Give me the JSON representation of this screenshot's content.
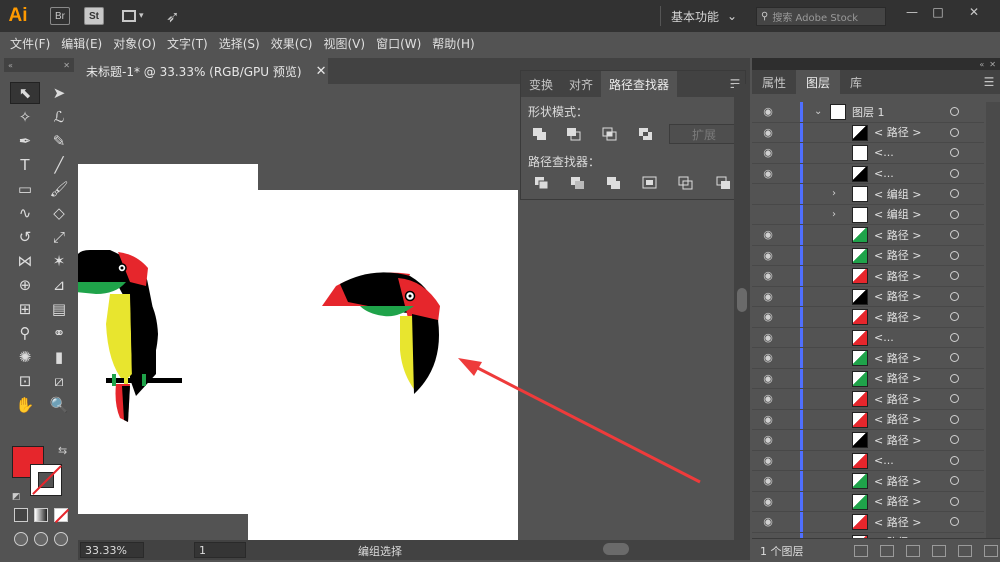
{
  "app": {
    "logo": "Ai",
    "bridge_icon": "Br",
    "stock_icon": "St",
    "workspace_label": "基本功能",
    "search_placeholder": "搜索 Adobe Stock"
  },
  "menu": [
    "文件(F)",
    "编辑(E)",
    "对象(O)",
    "文字(T)",
    "选择(S)",
    "效果(C)",
    "视图(V)",
    "窗口(W)",
    "帮助(H)"
  ],
  "document": {
    "tab_title": "未标题-1* @ 33.33% (RGB/GPU 预览)",
    "zoom": "33.33%",
    "page": "1",
    "status": "编组选择"
  },
  "pathfinder": {
    "tabs": [
      "变换",
      "对齐",
      "路径查找器"
    ],
    "shape_modes_label": "形状模式：",
    "pathfinders_label": "路径查找器：",
    "expand_label": "扩展"
  },
  "right_panel": {
    "tabs": [
      "属性",
      "图层",
      "库"
    ],
    "footer_text": "1 个图层",
    "layer_name": "图层 1",
    "rows": [
      {
        "label": "< 路径 >",
        "visible": true,
        "expandable": false
      },
      {
        "label": "<...",
        "visible": true,
        "expandable": false
      },
      {
        "label": "<...",
        "visible": true,
        "expandable": false
      },
      {
        "label": "< 编组 >",
        "visible": false,
        "expandable": true
      },
      {
        "label": "< 编组 >",
        "visible": false,
        "expandable": true
      },
      {
        "label": "< 路径 >",
        "visible": true,
        "expandable": false
      },
      {
        "label": "< 路径 >",
        "visible": true,
        "expandable": false
      },
      {
        "label": "< 路径 >",
        "visible": true,
        "expandable": false
      },
      {
        "label": "< 路径 >",
        "visible": true,
        "expandable": false
      },
      {
        "label": "< 路径 >",
        "visible": true,
        "expandable": false
      },
      {
        "label": "<...",
        "visible": true,
        "expandable": false
      },
      {
        "label": "< 路径 >",
        "visible": true,
        "expandable": false
      },
      {
        "label": "< 路径 >",
        "visible": true,
        "expandable": false
      },
      {
        "label": "< 路径 >",
        "visible": true,
        "expandable": false
      },
      {
        "label": "< 路径 >",
        "visible": true,
        "expandable": false
      },
      {
        "label": "< 路径 >",
        "visible": true,
        "expandable": false
      },
      {
        "label": "<...",
        "visible": true,
        "expandable": false
      },
      {
        "label": "< 路径 >",
        "visible": true,
        "expandable": false
      },
      {
        "label": "< 路径 >",
        "visible": true,
        "expandable": false
      },
      {
        "label": "< 路径 >",
        "visible": true,
        "expandable": false
      },
      {
        "label": "< 路径 >",
        "visible": true,
        "expandable": false
      }
    ]
  },
  "colors": {
    "fill": "#e6262c",
    "accent_arrow": "#ee3b3b",
    "layer_color": "#4f6fff"
  }
}
